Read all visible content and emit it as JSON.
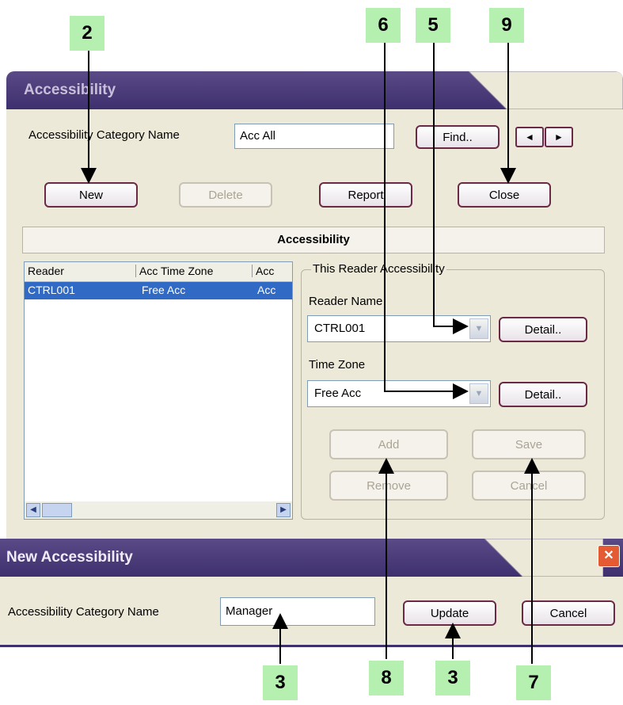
{
  "callouts": [
    "2",
    "6",
    "5",
    "9",
    "3",
    "8",
    "3",
    "7"
  ],
  "main_window": {
    "title": "Accessibility",
    "category_label": "Accessibility Category Name",
    "category_value": "Acc All",
    "find_label": "Find..",
    "prev_glyph": "◄",
    "next_glyph": "►",
    "new_label": "New",
    "delete_label": "Delete",
    "report_label": "Report",
    "close_label": "Close",
    "section_title": "Accessibility",
    "list": {
      "columns": [
        "Reader",
        "Acc Time Zone",
        "Acc"
      ],
      "rows": [
        [
          "CTRL001",
          "Free Acc",
          "Acc"
        ]
      ]
    },
    "group_title": "This Reader Accessibility",
    "reader_name_label": "Reader Name",
    "reader_name_value": "CTRL001",
    "time_zone_label": "Time Zone",
    "time_zone_value": "Free Acc",
    "detail_label": "Detail..",
    "add_label": "Add",
    "save_label": "Save",
    "remove_label": "Remove",
    "cancel_label": "Cancel"
  },
  "new_dialog": {
    "title": "New Accessibility",
    "category_label": "Accessibility Category Name",
    "category_value": "Manager",
    "update_label": "Update",
    "cancel_label": "Cancel",
    "close_glyph": "✕"
  },
  "colors": {
    "titlebar": "#3e2f6e",
    "selection": "#316ac5",
    "callout_bg": "#b6f0b0",
    "button_border": "#6a2a46"
  }
}
